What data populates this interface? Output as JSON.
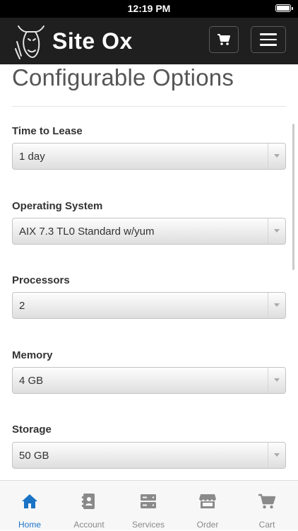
{
  "status_bar": {
    "time": "12:19 PM"
  },
  "header": {
    "brand": "Site Ox",
    "cart_icon": "cart-icon",
    "menu_icon": "hamburger-icon"
  },
  "page": {
    "title": "Configurable Options",
    "fields": [
      {
        "label": "Time to Lease",
        "value": "1 day"
      },
      {
        "label": "Operating System",
        "value": "AIX 7.3 TL0 Standard w/yum"
      },
      {
        "label": "Processors",
        "value": "2"
      },
      {
        "label": "Memory",
        "value": "4 GB"
      },
      {
        "label": "Storage",
        "value": "50 GB"
      }
    ]
  },
  "bottom_nav": {
    "items": [
      {
        "label": "Home",
        "icon": "home-icon",
        "active": true
      },
      {
        "label": "Account",
        "icon": "account-icon",
        "active": false
      },
      {
        "label": "Services",
        "icon": "services-icon",
        "active": false
      },
      {
        "label": "Order",
        "icon": "store-icon",
        "active": false
      },
      {
        "label": "Cart",
        "icon": "cart-icon",
        "active": false
      }
    ]
  },
  "colors": {
    "header_bg": "#1f1f1f",
    "active_nav": "#1a73c5",
    "inactive_nav": "#8a8a8a"
  }
}
